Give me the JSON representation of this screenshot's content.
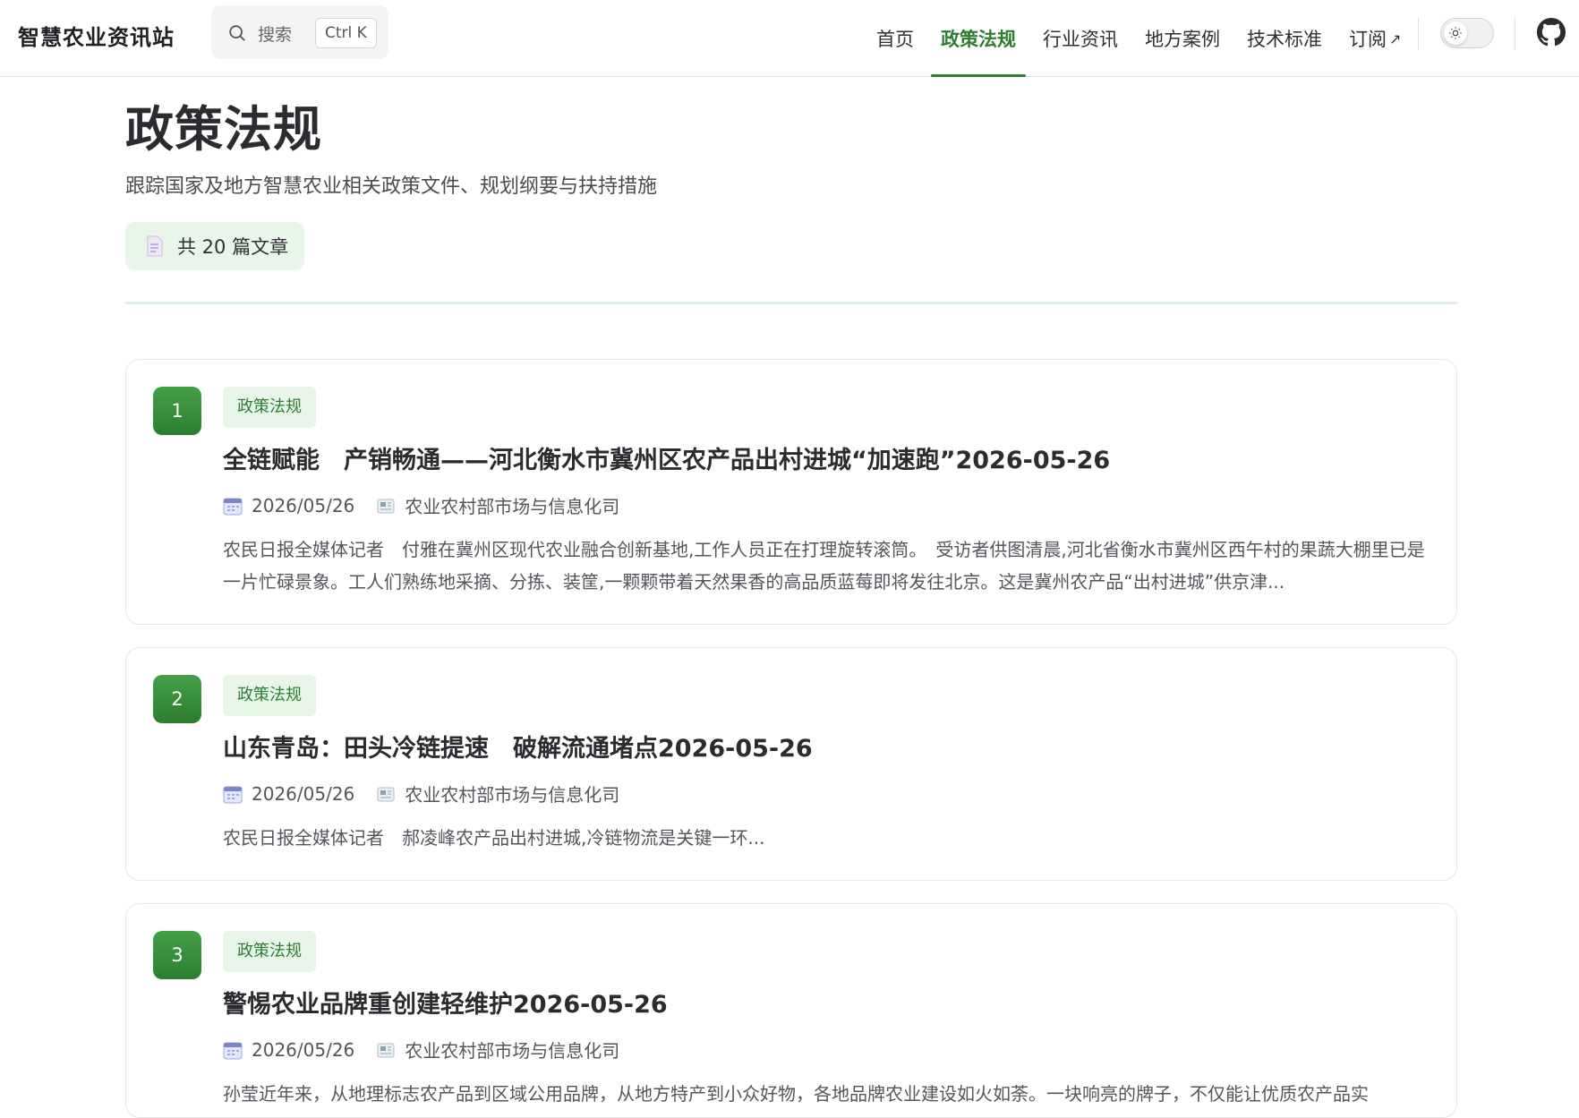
{
  "brand": "智慧农业资讯站",
  "search": {
    "placeholder": "搜索",
    "shortcut": "Ctrl K"
  },
  "nav": {
    "items": [
      {
        "label": "首页"
      },
      {
        "label": "政策法规",
        "active": true
      },
      {
        "label": "行业资讯"
      },
      {
        "label": "地方案例"
      },
      {
        "label": "技术标准"
      },
      {
        "label": "订阅",
        "external": true
      }
    ],
    "ext_arrow": "↗"
  },
  "theme_toggle": {
    "icon": "sun-icon",
    "state": "light"
  },
  "github_icon": "github-icon",
  "page": {
    "title": "政策法规",
    "description": "跟踪国家及地方智慧农业相关政策文件、规划纲要与扶持措施",
    "count_label": "共 20 篇文章"
  },
  "colors": {
    "accent": "#2e7d32",
    "tag_bg": "#e8f5e9"
  },
  "articles": [
    {
      "num": "1",
      "tag": "政策法规",
      "title": "全链赋能　产销畅通——河北衡水市冀州区农产品出村进城“加速跑”2026-05-26",
      "date": "2026/05/26",
      "source": "农业农村部市场与信息化司",
      "excerpt": "农民日报全媒体记者　付雅在冀州区现代农业融合创新基地,工作人员正在打理旋转滚筒。　受访者供图清晨,河北省衡水市冀州区西午村的果蔬大棚里已是一片忙碌景象。工人们熟练地采摘、分拣、装筐,一颗颗带着天然果香的高品质蓝莓即将发往北京。这是冀州农产品“出村进城”供京津..."
    },
    {
      "num": "2",
      "tag": "政策法规",
      "title": "山东青岛：田头冷链提速　破解流通堵点2026-05-26",
      "date": "2026/05/26",
      "source": "农业农村部市场与信息化司",
      "excerpt": "农民日报全媒体记者　郝凌峰农产品出村进城,冷链物流是关键一环..."
    },
    {
      "num": "3",
      "tag": "政策法规",
      "title": "警惕农业品牌重创建轻维护2026-05-26",
      "date": "2026/05/26",
      "source": "农业农村部市场与信息化司",
      "excerpt": "孙莹近年来，从地理标志农产品到区域公用品牌，从地方特产到小众好物，各地品牌农业建设如火如荼。一块响亮的牌子，不仅能让优质农产品实"
    }
  ]
}
